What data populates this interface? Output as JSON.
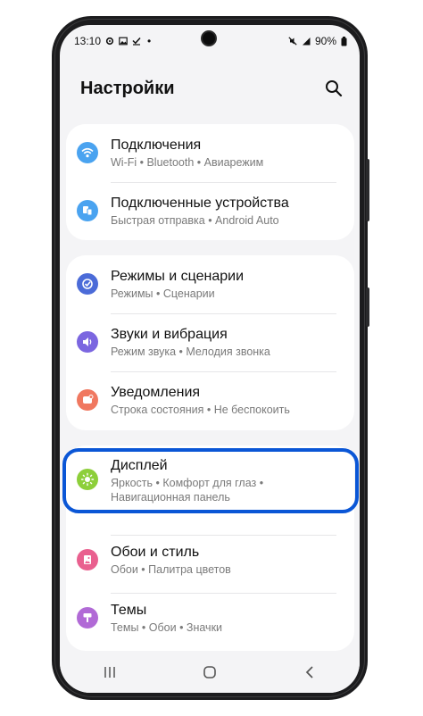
{
  "status_bar": {
    "time": "13:10",
    "dot": "•",
    "battery": "90%"
  },
  "header": {
    "title": "Настройки"
  },
  "colors": {
    "highlight": "#0a56d6",
    "connections": "#4aa3f0",
    "devices": "#4aa3f0",
    "modes": "#4b6bd8",
    "sounds": "#7b66e0",
    "notifications": "#f07860",
    "display": "#8dcf3a",
    "wallpaper": "#e9608f",
    "themes": "#b16ad6"
  },
  "groups": [
    {
      "items": [
        {
          "name": "Подключения",
          "sub": "Wi-Fi  •  Bluetooth  •  Авиарежим",
          "icon": "wifi-icon"
        },
        {
          "name": "Подключенные устройства",
          "sub": "Быстрая отправка  •  Android Auto",
          "icon": "devices-icon"
        }
      ]
    },
    {
      "items": [
        {
          "name": "Режимы и сценарии",
          "sub": "Режимы  •  Сценарии",
          "icon": "modes-icon"
        },
        {
          "name": "Звуки и вибрация",
          "sub": "Режим звука  •  Мелодия звонка",
          "icon": "speaker-icon"
        },
        {
          "name": "Уведомления",
          "sub": "Строка состояния  •  Не беспокоить",
          "icon": "notification-icon"
        }
      ]
    },
    {
      "items": [
        {
          "name": "Дисплей",
          "sub": "Яркость  •  Комфорт для глаз  •",
          "sub2": "Навигационная панель",
          "icon": "brightness-icon"
        },
        {
          "name": "Обои и стиль",
          "sub": "Обои  •  Палитра цветов",
          "icon": "wallpaper-icon"
        },
        {
          "name": "Темы",
          "sub": "Темы  •  Обои  •  Значки",
          "icon": "themes-icon"
        }
      ]
    }
  ]
}
